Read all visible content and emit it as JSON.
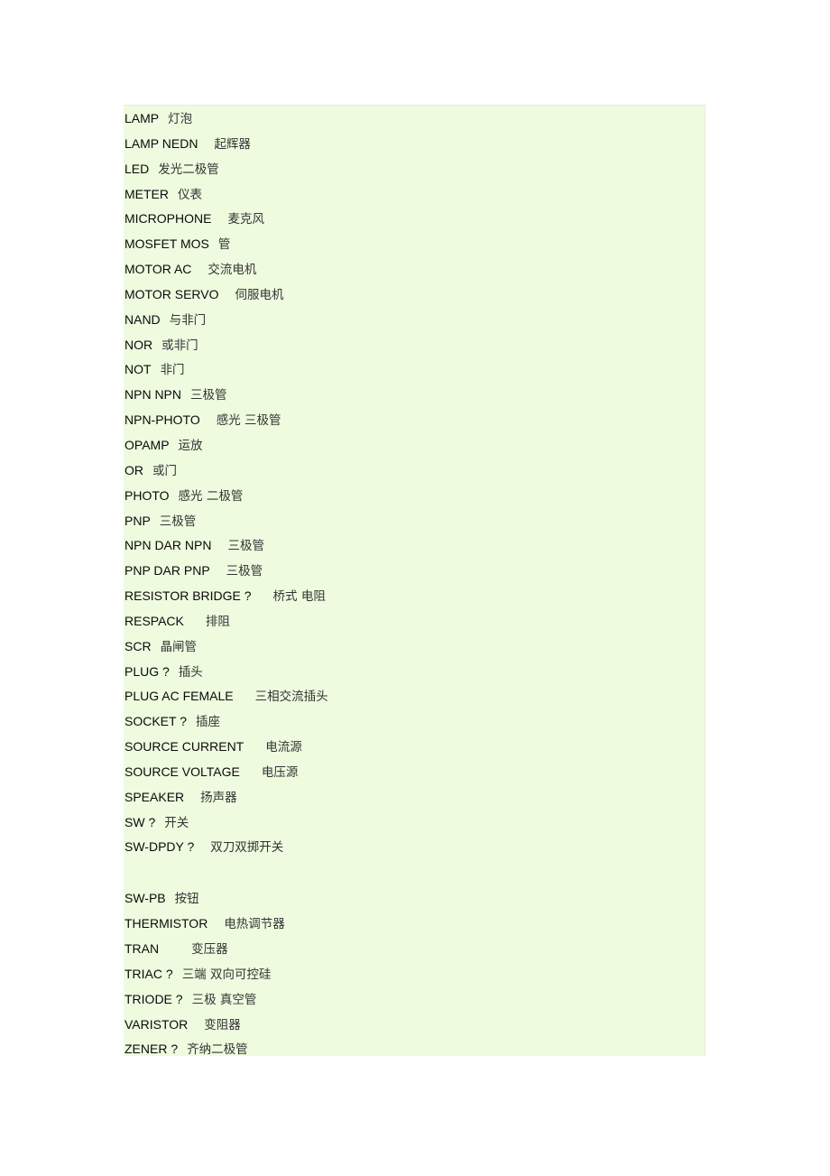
{
  "document": {
    "panel_background": "#eefbdf",
    "entries": [
      {
        "term": "LAMP",
        "zh": "灯泡",
        "gap": 1
      },
      {
        "term": "LAMP NEDN",
        "zh": "起辉器",
        "gap": 2
      },
      {
        "term": "LED",
        "zh": "发光二极管",
        "gap": 1
      },
      {
        "term": "METER",
        "zh": "仪表",
        "gap": 1
      },
      {
        "term": "MICROPHONE",
        "zh": "麦克风",
        "gap": 2
      },
      {
        "term": "MOSFET MOS",
        "zh": "管",
        "gap": 1
      },
      {
        "term": "MOTOR AC",
        "zh": "交流电机",
        "gap": 2
      },
      {
        "term": "MOTOR SERVO",
        "zh": "伺服电机",
        "gap": 2
      },
      {
        "term": "NAND",
        "zh": "与非门",
        "gap": 1
      },
      {
        "term": "NOR",
        "zh": "或非门",
        "gap": 1
      },
      {
        "term": "NOT",
        "zh": "非门",
        "gap": 1
      },
      {
        "term": "NPN NPN",
        "zh": "三极管",
        "gap": 1
      },
      {
        "term": "NPN-PHOTO",
        "zh": "感光 三极管",
        "gap": 2
      },
      {
        "term": "OPAMP",
        "zh": "运放",
        "gap": 1
      },
      {
        "term": "OR",
        "zh": "或门",
        "gap": 1
      },
      {
        "term": "PHOTO",
        "zh": "感光 二极管",
        "gap": 1
      },
      {
        "term": "PNP",
        "zh": "三极管",
        "gap": 1
      },
      {
        "term": "NPN DAR NPN",
        "zh": "三极管",
        "gap": 2
      },
      {
        "term": "PNP DAR PNP",
        "zh": "三极管",
        "gap": 2
      },
      {
        "term": "RESISTOR BRIDGE ?",
        "zh": "桥式 电阻",
        "gap": 3
      },
      {
        "term": "RESPACK",
        "zh": "排阻",
        "gap": 3
      },
      {
        "term": "SCR",
        "zh": "晶闸管",
        "gap": 1
      },
      {
        "term": "PLUG ?",
        "zh": "插头",
        "gap": 1
      },
      {
        "term": "PLUG AC FEMALE",
        "zh": "三相交流插头",
        "gap": 3
      },
      {
        "term": "SOCKET ?",
        "zh": "插座",
        "gap": 1
      },
      {
        "term": "SOURCE CURRENT",
        "zh": "电流源",
        "gap": 3
      },
      {
        "term": "SOURCE VOLTAGE",
        "zh": "电压源",
        "gap": 3
      },
      {
        "term": "SPEAKER",
        "zh": "扬声器",
        "gap": 2
      },
      {
        "term": "SW ?",
        "zh": "开关",
        "gap": 1
      },
      {
        "term": "SW-DPDY ?",
        "zh": "双刀双掷开关",
        "gap": 2
      },
      {
        "spacer": true
      },
      {
        "term": "SW-PB",
        "zh": "按钮",
        "gap": 1
      },
      {
        "term": "THERMISTOR",
        "zh": "电热调节器",
        "gap": 2
      },
      {
        "term": "TRAN",
        "zh": "变压器",
        "gap": 4
      },
      {
        "term": "TRIAC ?",
        "zh": "三端 双向可控硅",
        "gap": 1
      },
      {
        "term": "TRIODE ?",
        "zh": "三极 真空管",
        "gap": 1
      },
      {
        "term": "VARISTOR",
        "zh": "变阻器",
        "gap": 2
      },
      {
        "term": "ZENER ?",
        "zh": "齐纳二极管",
        "gap": 1
      }
    ]
  }
}
